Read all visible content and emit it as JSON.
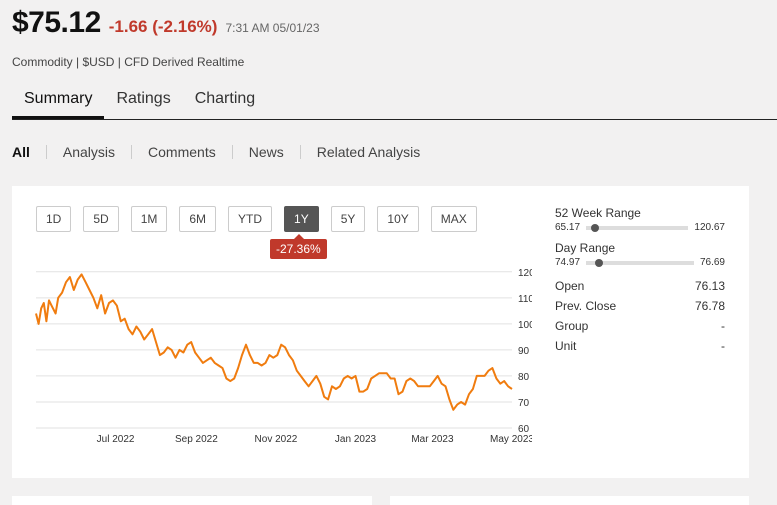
{
  "quote": {
    "price": "$75.12",
    "change": "-1.66 (-2.16%)",
    "timestamp": "7:31 AM 05/01/23",
    "subtitle": "Commodity | $USD | CFD Derived Realtime"
  },
  "main_tabs": [
    {
      "label": "Summary",
      "active": true
    },
    {
      "label": "Ratings",
      "active": false
    },
    {
      "label": "Charting",
      "active": false
    }
  ],
  "sub_tabs": [
    {
      "label": "All",
      "active": true
    },
    {
      "label": "Analysis",
      "active": false
    },
    {
      "label": "Comments",
      "active": false
    },
    {
      "label": "News",
      "active": false
    },
    {
      "label": "Related Analysis",
      "active": false
    }
  ],
  "range_buttons": [
    {
      "label": "1D",
      "active": false
    },
    {
      "label": "5D",
      "active": false
    },
    {
      "label": "1M",
      "active": false
    },
    {
      "label": "6M",
      "active": false
    },
    {
      "label": "YTD",
      "active": false
    },
    {
      "label": "1Y",
      "active": true
    },
    {
      "label": "5Y",
      "active": false
    },
    {
      "label": "10Y",
      "active": false
    },
    {
      "label": "MAX",
      "active": false
    }
  ],
  "period_change": "-27.36%",
  "colors": {
    "accent_red": "#c0392b",
    "line": "#f07c0f"
  },
  "stats": {
    "week52": {
      "title": "52 Week Range",
      "low": "65.17",
      "high": "120.67",
      "position": 0.09
    },
    "day": {
      "title": "Day Range",
      "low": "74.97",
      "high": "76.69",
      "position": 0.12
    },
    "rows": [
      {
        "label": "Open",
        "value": "76.13"
      },
      {
        "label": "Prev. Close",
        "value": "76.78"
      },
      {
        "label": "Group",
        "value": "-"
      },
      {
        "label": "Unit",
        "value": "-"
      }
    ]
  },
  "chart_data": {
    "type": "line",
    "x_ticks": [
      "Jul 2022",
      "Sep 2022",
      "Nov 2022",
      "Jan 2023",
      "Mar 2023",
      "May 2023"
    ],
    "x_tick_dates": [
      "2022-07-01",
      "2022-09-01",
      "2022-11-01",
      "2023-01-01",
      "2023-03-01",
      "2023-05-01"
    ],
    "y_ticks": [
      60,
      70,
      80,
      90,
      100,
      110,
      120
    ],
    "ylim": [
      60,
      123
    ],
    "xlim": [
      "2022-05-01",
      "2023-05-01"
    ],
    "grid": true,
    "series": [
      {
        "values": [
          [
            "2022-05-01",
            104
          ],
          [
            "2022-05-03",
            100
          ],
          [
            "2022-05-05",
            106
          ],
          [
            "2022-05-07",
            108
          ],
          [
            "2022-05-09",
            101
          ],
          [
            "2022-05-11",
            109
          ],
          [
            "2022-05-13",
            107
          ],
          [
            "2022-05-16",
            104
          ],
          [
            "2022-05-18",
            110
          ],
          [
            "2022-05-21",
            112
          ],
          [
            "2022-05-24",
            116
          ],
          [
            "2022-05-27",
            118
          ],
          [
            "2022-05-30",
            113
          ],
          [
            "2022-06-02",
            117
          ],
          [
            "2022-06-05",
            119
          ],
          [
            "2022-06-08",
            116
          ],
          [
            "2022-06-11",
            113
          ],
          [
            "2022-06-14",
            110
          ],
          [
            "2022-06-17",
            106
          ],
          [
            "2022-06-20",
            111
          ],
          [
            "2022-06-23",
            104
          ],
          [
            "2022-06-26",
            108
          ],
          [
            "2022-06-29",
            109
          ],
          [
            "2022-07-02",
            107
          ],
          [
            "2022-07-05",
            101
          ],
          [
            "2022-07-08",
            102
          ],
          [
            "2022-07-11",
            98
          ],
          [
            "2022-07-14",
            96
          ],
          [
            "2022-07-17",
            99
          ],
          [
            "2022-07-20",
            97
          ],
          [
            "2022-07-23",
            94
          ],
          [
            "2022-07-26",
            96
          ],
          [
            "2022-07-29",
            98
          ],
          [
            "2022-08-01",
            93
          ],
          [
            "2022-08-04",
            88
          ],
          [
            "2022-08-07",
            89
          ],
          [
            "2022-08-10",
            91
          ],
          [
            "2022-08-13",
            90
          ],
          [
            "2022-08-16",
            87
          ],
          [
            "2022-08-19",
            90
          ],
          [
            "2022-08-22",
            89
          ],
          [
            "2022-08-25",
            92
          ],
          [
            "2022-08-28",
            93
          ],
          [
            "2022-08-31",
            89
          ],
          [
            "2022-09-03",
            87
          ],
          [
            "2022-09-06",
            85
          ],
          [
            "2022-09-09",
            86
          ],
          [
            "2022-09-12",
            87
          ],
          [
            "2022-09-15",
            85
          ],
          [
            "2022-09-18",
            84
          ],
          [
            "2022-09-21",
            83
          ],
          [
            "2022-09-24",
            79
          ],
          [
            "2022-09-27",
            78
          ],
          [
            "2022-09-30",
            79
          ],
          [
            "2022-10-03",
            83
          ],
          [
            "2022-10-06",
            88
          ],
          [
            "2022-10-09",
            92
          ],
          [
            "2022-10-12",
            88
          ],
          [
            "2022-10-15",
            85
          ],
          [
            "2022-10-18",
            85
          ],
          [
            "2022-10-21",
            84
          ],
          [
            "2022-10-24",
            85
          ],
          [
            "2022-10-27",
            88
          ],
          [
            "2022-10-30",
            87
          ],
          [
            "2022-11-02",
            88
          ],
          [
            "2022-11-05",
            92
          ],
          [
            "2022-11-08",
            91
          ],
          [
            "2022-11-11",
            88
          ],
          [
            "2022-11-14",
            86
          ],
          [
            "2022-11-17",
            82
          ],
          [
            "2022-11-20",
            80
          ],
          [
            "2022-11-23",
            78
          ],
          [
            "2022-11-26",
            76
          ],
          [
            "2022-11-29",
            78
          ],
          [
            "2022-12-02",
            80
          ],
          [
            "2022-12-05",
            77
          ],
          [
            "2022-12-08",
            72
          ],
          [
            "2022-12-11",
            71
          ],
          [
            "2022-12-14",
            76
          ],
          [
            "2022-12-17",
            75
          ],
          [
            "2022-12-20",
            76
          ],
          [
            "2022-12-23",
            79
          ],
          [
            "2022-12-26",
            80
          ],
          [
            "2022-12-29",
            79
          ],
          [
            "2023-01-01",
            80
          ],
          [
            "2023-01-04",
            74
          ],
          [
            "2023-01-07",
            74
          ],
          [
            "2023-01-10",
            75
          ],
          [
            "2023-01-13",
            79
          ],
          [
            "2023-01-16",
            80
          ],
          [
            "2023-01-19",
            81
          ],
          [
            "2023-01-22",
            81
          ],
          [
            "2023-01-25",
            81
          ],
          [
            "2023-01-28",
            79
          ],
          [
            "2023-01-31",
            79
          ],
          [
            "2023-02-03",
            73
          ],
          [
            "2023-02-06",
            74
          ],
          [
            "2023-02-09",
            78
          ],
          [
            "2023-02-12",
            79
          ],
          [
            "2023-02-15",
            78
          ],
          [
            "2023-02-18",
            76
          ],
          [
            "2023-02-21",
            76
          ],
          [
            "2023-02-24",
            76
          ],
          [
            "2023-02-27",
            76
          ],
          [
            "2023-03-02",
            78
          ],
          [
            "2023-03-05",
            80
          ],
          [
            "2023-03-08",
            77
          ],
          [
            "2023-03-11",
            76
          ],
          [
            "2023-03-14",
            71
          ],
          [
            "2023-03-17",
            67
          ],
          [
            "2023-03-20",
            69
          ],
          [
            "2023-03-23",
            70
          ],
          [
            "2023-03-26",
            69
          ],
          [
            "2023-03-29",
            73
          ],
          [
            "2023-04-01",
            75
          ],
          [
            "2023-04-04",
            80
          ],
          [
            "2023-04-07",
            80
          ],
          [
            "2023-04-10",
            80
          ],
          [
            "2023-04-13",
            82
          ],
          [
            "2023-04-16",
            83
          ],
          [
            "2023-04-19",
            79
          ],
          [
            "2023-04-22",
            77
          ],
          [
            "2023-04-25",
            78
          ],
          [
            "2023-04-28",
            76
          ],
          [
            "2023-05-01",
            75
          ]
        ]
      }
    ]
  }
}
